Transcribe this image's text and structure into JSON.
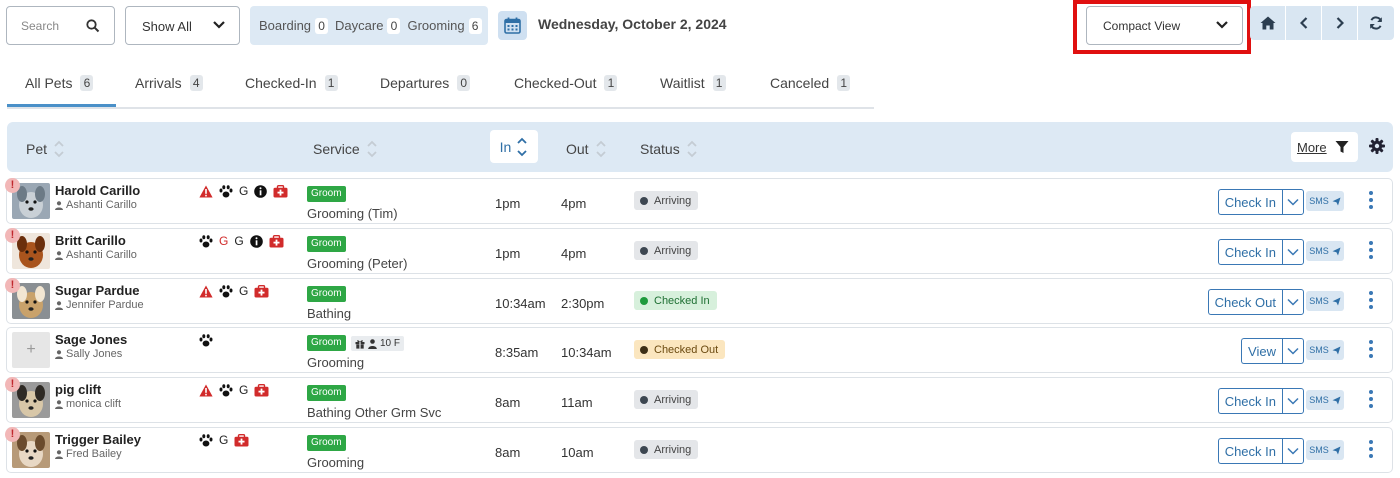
{
  "toolbar": {
    "search_placeholder": "Search",
    "filter_label": "Show All",
    "counts": [
      {
        "label": "Boarding",
        "count": "0"
      },
      {
        "label": "Daycare",
        "count": "0"
      },
      {
        "label": "Grooming",
        "count": "6"
      }
    ],
    "date": "Wednesday, October 2, 2024",
    "view_label": "Compact View",
    "highlight_color": "#e01010"
  },
  "tabs": [
    {
      "label": "All Pets",
      "count": "6",
      "active": true
    },
    {
      "label": "Arrivals",
      "count": "4"
    },
    {
      "label": "Checked-In",
      "count": "1"
    },
    {
      "label": "Departures",
      "count": "0"
    },
    {
      "label": "Checked-Out",
      "count": "1"
    },
    {
      "label": "Waitlist",
      "count": "1"
    },
    {
      "label": "Canceled",
      "count": "1"
    }
  ],
  "columns": {
    "pet": "Pet",
    "service": "Service",
    "in": "In",
    "out": "Out",
    "status": "Status",
    "more": "More"
  },
  "rows": [
    {
      "name": "Harold Carillo",
      "owner": "Ashanti Carillo",
      "icons": [
        "warning-icon",
        "paw-icon",
        "g",
        "info-icon",
        "medical-icon"
      ],
      "tag": "Groom",
      "service": "Grooming (Tim)",
      "in": "1pm",
      "out": "4pm",
      "status": "Arriving",
      "action": "Check In",
      "sms": "SMS",
      "alert": "!"
    },
    {
      "name": "Britt Carillo",
      "owner": "Ashanti Carillo",
      "icons": [
        "paw-icon",
        "g-red",
        "g",
        "info-icon",
        "medical-icon"
      ],
      "tag": "Groom",
      "service": "Grooming (Peter)",
      "in": "1pm",
      "out": "4pm",
      "status": "Arriving",
      "action": "Check In",
      "sms": "SMS",
      "alert": "!"
    },
    {
      "name": "Sugar Pardue",
      "owner": "Jennifer Pardue",
      "icons": [
        "warning-icon",
        "paw-icon",
        "g",
        "medical-icon"
      ],
      "tag": "Groom",
      "service": "Bathing",
      "in": "10:34am",
      "out": "2:30pm",
      "status": "Checked In",
      "action": "Check Out",
      "sms": "SMS",
      "alert": "!"
    },
    {
      "name": "Sage Jones",
      "owner": "Sally Jones",
      "icons": [
        "paw-icon"
      ],
      "tag": "Groom",
      "extra": "10 F",
      "service": "Grooming",
      "in": "8:35am",
      "out": "10:34am",
      "status": "Checked Out",
      "action": "View",
      "sms": "SMS",
      "alert": ""
    },
    {
      "name": "pig clift",
      "owner": "monica clift",
      "icons": [
        "warning-icon",
        "paw-icon",
        "g",
        "medical-icon"
      ],
      "tag": "Groom",
      "service": "Bathing Other Grm Svc",
      "in": "8am",
      "out": "11am",
      "status": "Arriving",
      "action": "Check In",
      "sms": "SMS",
      "alert": "!"
    },
    {
      "name": "Trigger Bailey",
      "owner": "Fred Bailey",
      "icons": [
        "paw-icon",
        "g",
        "medical-icon"
      ],
      "tag": "Groom",
      "service": "Grooming",
      "in": "8am",
      "out": "10am",
      "status": "Arriving",
      "action": "Check In",
      "sms": "SMS",
      "alert": "!"
    }
  ],
  "g_letter": "G",
  "blank_photo": "+"
}
